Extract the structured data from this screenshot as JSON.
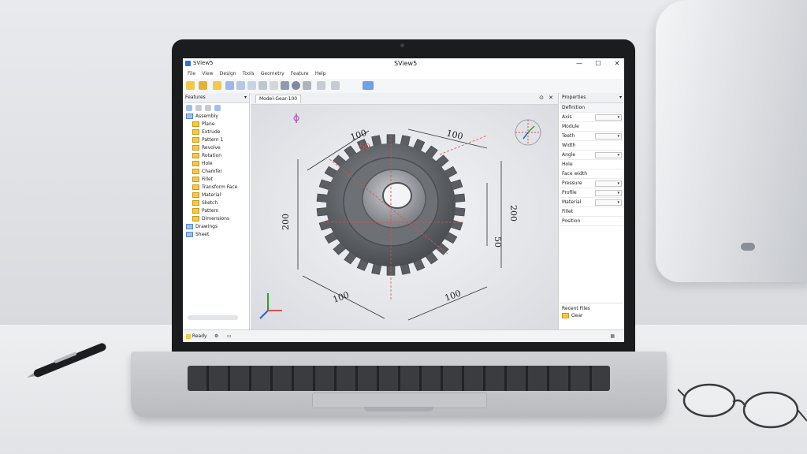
{
  "app": {
    "name": "SView5",
    "window_title": "SView5",
    "window_controls": [
      "—",
      "☐",
      "✕"
    ]
  },
  "menu": [
    "File",
    "View",
    "Design",
    "Tools",
    "Geometry",
    "Feature",
    "Help"
  ],
  "toolbar_icons": [
    "open-icon",
    "save-icon",
    "folder-icon",
    "zoom-icon",
    "search-icon",
    "rotate-icon",
    "pan-icon",
    "sketch-icon",
    "shade-icon",
    "wireframe-icon",
    "measure-icon",
    "dimension-icon",
    "section-icon",
    "view-icon"
  ],
  "tree_panel": {
    "title": "Features",
    "items": [
      {
        "label": "Assembly",
        "root": true
      },
      {
        "label": "Plane"
      },
      {
        "label": "Extrude"
      },
      {
        "label": "Pattern 1"
      },
      {
        "label": "Revolve"
      },
      {
        "label": "Rotation"
      },
      {
        "label": "Hole"
      },
      {
        "label": "Chamfer"
      },
      {
        "label": "Fillet"
      },
      {
        "label": "Transform Face"
      },
      {
        "label": "Material"
      },
      {
        "label": "Sketch"
      },
      {
        "label": "Pattern"
      },
      {
        "label": "Dimensions"
      },
      {
        "label": "Drawings",
        "root": true
      },
      {
        "label": "Sheet",
        "root": true
      }
    ]
  },
  "viewport": {
    "tab_label": "Model-Gear-100",
    "dimensions": {
      "top_left": "100",
      "top_right": "100",
      "radius": "50",
      "left_height": "200",
      "right_height": "200",
      "right_small": "50",
      "bottom_left": "100",
      "bottom_right": "100"
    }
  },
  "properties": {
    "title": "Properties",
    "tab": "Definition",
    "rows": [
      {
        "label": "Axis",
        "dropdown": true
      },
      {
        "label": "Module"
      },
      {
        "label": "Teeth",
        "dropdown": true
      },
      {
        "label": "Width"
      },
      {
        "label": "Angle",
        "dropdown": true
      },
      {
        "label": "Hole"
      },
      {
        "label": "Face width"
      },
      {
        "label": "Pressure",
        "dropdown": true
      },
      {
        "label": "Profile",
        "dropdown": true
      },
      {
        "label": "Material",
        "dropdown": true
      },
      {
        "label": "Fillet"
      },
      {
        "label": "Position"
      }
    ],
    "footer_title": "Recent Files",
    "footer_item": "Gear"
  },
  "status": {
    "left": "Ready",
    "colors": {
      "accent": "#2d6fd6",
      "dimension_red": "#d9534f",
      "axis_green": "#29a329",
      "axis_blue": "#2962d9"
    }
  }
}
